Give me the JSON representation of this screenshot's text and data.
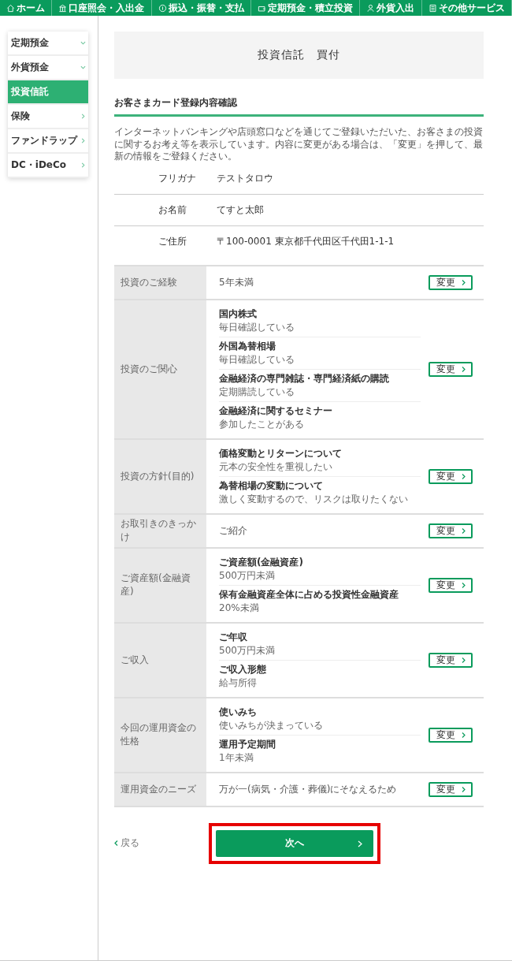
{
  "nav": [
    {
      "label": "ホーム"
    },
    {
      "label": "口座照会・入出金"
    },
    {
      "label": "振込・振替・支払"
    },
    {
      "label": "定期預金・積立投資"
    },
    {
      "label": "外貨入出"
    },
    {
      "label": "その他サービス"
    }
  ],
  "sidebar": {
    "items": [
      {
        "label": "定期預金",
        "kind": "dropdown",
        "selected": false
      },
      {
        "label": "外貨預金",
        "kind": "dropdown",
        "selected": false
      },
      {
        "label": "投資信託",
        "selected": true
      },
      {
        "label": "保険",
        "kind": "link",
        "selected": false
      },
      {
        "label": "ファンドラップ",
        "kind": "link",
        "selected": false
      },
      {
        "label": "DC・iDeCo",
        "kind": "link",
        "selected": false
      }
    ]
  },
  "page_title": "投資信託　買付",
  "section_heading": "お客さまカード登録内容確認",
  "description": "インターネットバンキングや店頭窓口などを通じてご登録いただいた、お客さまの投資に関するお考え等を表示しています。内容に変更がある場合は、「変更」を押して、最新の情報をご登録ください。",
  "customer": [
    {
      "label": "フリガナ",
      "value": "テストタロウ"
    },
    {
      "label": "お名前",
      "value": "てすと太郎"
    },
    {
      "label": "ご住所",
      "value": "〒100-0001 東京都千代田区千代田1-1-1"
    }
  ],
  "profile": [
    {
      "label": "投資のご経験",
      "kind": "single",
      "value": "5年未満",
      "button": "変更"
    },
    {
      "label": "投資のご関心",
      "kind": "multi",
      "items": [
        {
          "title": "国内株式",
          "value": "毎日確認している"
        },
        {
          "title": "外国為替相場",
          "value": "毎日確認している"
        },
        {
          "title": "金融経済の専門雑誌・専門経済紙の購読",
          "value": "定期購読している"
        },
        {
          "title": "金融経済に関するセミナー",
          "value": "参加したことがある"
        }
      ],
      "button": "変更"
    },
    {
      "label": "投資の方針(目的)",
      "kind": "multi",
      "items": [
        {
          "title": "価格変動とリターンについて",
          "value": "元本の安全性を重視したい"
        },
        {
          "title": "為替相場の変動について",
          "value": "激しく変動するので、リスクは取りたくない"
        }
      ],
      "button": "変更"
    },
    {
      "label": "お取引きのきっかけ",
      "kind": "single",
      "value": "ご紹介",
      "button": "変更"
    },
    {
      "label": "ご資産額(金融資産)",
      "kind": "multi",
      "items": [
        {
          "title": "ご資産額(金融資産)",
          "value": "500万円未満"
        },
        {
          "title": "保有金融資産全体に占める投資性金融資産",
          "value": "20%未満"
        }
      ],
      "button": "変更"
    },
    {
      "label": "ご収入",
      "kind": "multi",
      "items": [
        {
          "title": "ご年収",
          "value": "500万円未満"
        },
        {
          "title": "ご収入形態",
          "value": "給与所得"
        }
      ],
      "button": "変更"
    },
    {
      "label": "今回の運用資金の性格",
      "kind": "multi",
      "items": [
        {
          "title": "使いみち",
          "value": "使いみちが決まっている"
        },
        {
          "title": "運用予定期間",
          "value": "1年未満"
        }
      ],
      "button": "変更"
    },
    {
      "label": "運用資金のニーズ",
      "kind": "single",
      "value": "万が一(病気・介護・葬儀)にそなえるため",
      "button": "変更"
    }
  ],
  "back_link": "戻る",
  "next_button": {
    "label": "次へ",
    "highlighted": true
  }
}
